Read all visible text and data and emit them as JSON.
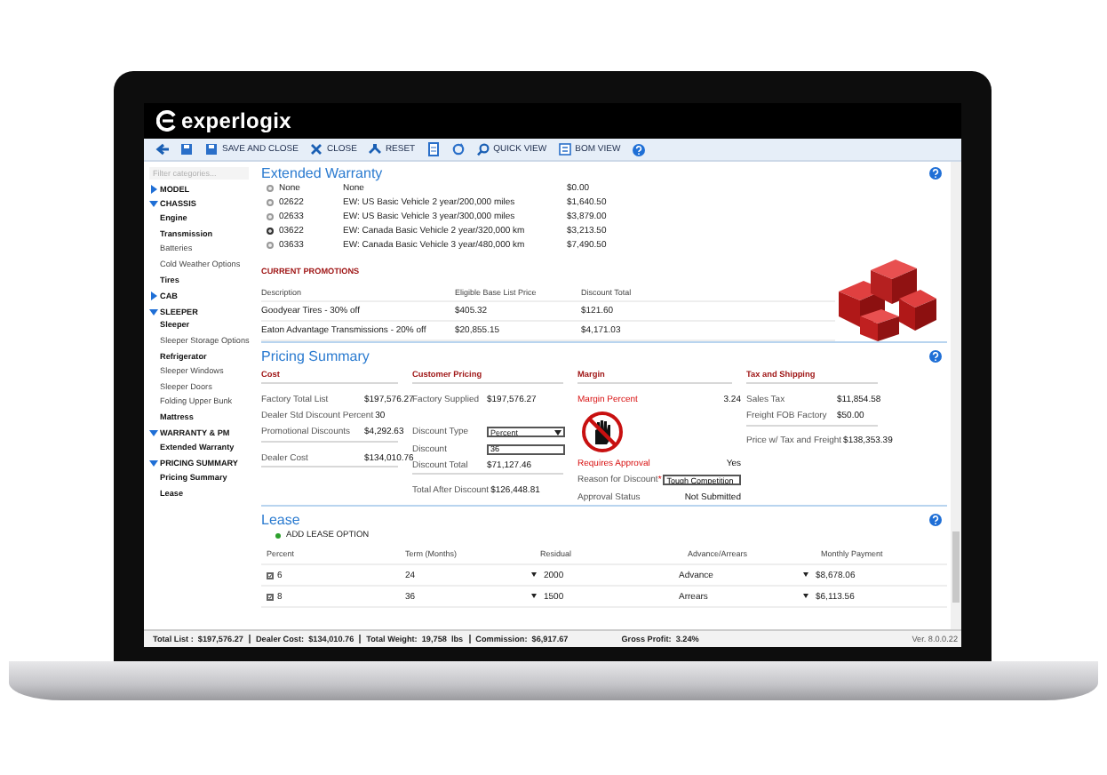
{
  "app": {
    "logo": "experlogix"
  },
  "toolbar": [
    "SAVE AND CLOSE",
    "CLOSE",
    "RESET",
    "QUICK VIEW",
    "BOM VIEW"
  ],
  "sidebar": {
    "filter_placeholder": "Filter categories...",
    "items": [
      {
        "label": "MODEL",
        "expanded": false
      },
      {
        "label": "CHASSIS",
        "expanded": true,
        "children": [
          {
            "label": "Engine",
            "completed": true
          },
          {
            "label": "Transmission",
            "completed": true
          },
          {
            "label": "Batteries",
            "completed": false
          },
          {
            "label": "Cold Weather Options",
            "completed": false
          },
          {
            "label": "Tires",
            "completed": true
          }
        ]
      },
      {
        "label": "CAB",
        "expanded": false
      },
      {
        "label": "SLEEPER",
        "expanded": true,
        "children": [
          {
            "label": "Sleeper",
            "completed": true
          },
          {
            "label": "Sleeper Storage Options",
            "completed": false
          },
          {
            "label": "Refrigerator",
            "completed": true
          },
          {
            "label": "Sleeper Windows",
            "completed": false
          },
          {
            "label": "Sleeper Doors",
            "completed": false
          },
          {
            "label": "Folding Upper Bunk",
            "completed": false
          },
          {
            "label": "Mattress",
            "completed": true
          }
        ]
      },
      {
        "label": "WARRANTY & PM",
        "expanded": true,
        "children": [
          {
            "label": "Extended Warranty",
            "completed": true
          }
        ]
      },
      {
        "label": "PRICING SUMMARY",
        "expanded": true,
        "children": [
          {
            "label": "Pricing Summary",
            "completed": true
          },
          {
            "label": "Lease",
            "completed": true
          }
        ]
      }
    ]
  },
  "extended_warranty": {
    "title": "Extended Warranty",
    "options": [
      {
        "code": "None",
        "description": "None",
        "price": "$0.00",
        "selected": false
      },
      {
        "code": "02622",
        "description": "EW: US Basic Vehicle 2 year/200,000 miles",
        "price": "$1,640.50",
        "selected": false
      },
      {
        "code": "02633",
        "description": "EW: US Basic Vehicle 3 year/300,000 miles",
        "price": "$3,879.00",
        "selected": false
      },
      {
        "code": "03622",
        "description": "EW: Canada Basic Vehicle 2 year/320,000 km",
        "price": "$3,213.50",
        "selected": true
      },
      {
        "code": "03633",
        "description": "EW: Canada Basic Vehicle 3 year/480,000 km",
        "price": "$7,490.50",
        "selected": false
      }
    ],
    "promotions": {
      "title": "CURRENT PROMOTIONS",
      "columns": [
        "Description",
        "Eligible Base List Price",
        "Discount Total"
      ],
      "rows": [
        [
          "Goodyear Tires - 30% off",
          "$405.32",
          "$121.60"
        ],
        [
          "Eaton Advantage Transmissions - 20% off",
          "$20,855.15",
          "$4,171.03"
        ]
      ]
    }
  },
  "pricing_summary": {
    "title": "Pricing Summary",
    "columns": [
      {
        "heading": "Cost",
        "rows": [
          {
            "kind": "divider"
          },
          {
            "kind": "field",
            "label": "Factory Total List",
            "value": "$197,576.27",
            "alert": false
          },
          {
            "kind": "field",
            "label": "Dealer Std Discount Percent",
            "value": "30",
            "alert": false
          },
          {
            "kind": "field",
            "label": "Promotional Discounts",
            "value": "$4,292.63",
            "alert": false
          },
          {
            "kind": "divider"
          },
          {
            "kind": "field",
            "label": "Dealer Cost",
            "value": "$134,010.76",
            "alert": false
          },
          {
            "kind": "divider"
          }
        ]
      },
      {
        "heading": "Customer Pricing",
        "rows": [
          {
            "kind": "divider"
          },
          {
            "kind": "field",
            "label": "Factory Supplied",
            "value": "$197,576.27",
            "alert": false
          },
          {
            "kind": "blank"
          },
          {
            "kind": "select",
            "label": "Discount Type",
            "value": "Percent",
            "alert": false
          },
          {
            "kind": "input",
            "label": "Discount",
            "value": "36",
            "alert": false
          },
          {
            "kind": "field",
            "label": "Discount Total",
            "value": "$71,127.46",
            "alert": false
          },
          {
            "kind": "divider"
          },
          {
            "kind": "field",
            "label": "Total After Discount",
            "value": "$126,448.81",
            "alert": false
          }
        ]
      },
      {
        "heading": "Margin",
        "rows": [
          {
            "kind": "divider"
          },
          {
            "kind": "field",
            "label": "Margin Percent",
            "value": "3.24",
            "alert": true
          },
          {
            "kind": "icon"
          },
          {
            "kind": "field",
            "label": "Requires Approval",
            "value": "Yes",
            "alert": true
          },
          {
            "kind": "input",
            "label": "Reason for Discount",
            "required_mark": "*",
            "value": "Tough Competition",
            "alert": false
          },
          {
            "kind": "field",
            "label": "Approval Status",
            "value": "Not Submitted",
            "alert": false
          }
        ]
      },
      {
        "heading": "Tax and Shipping",
        "rows": [
          {
            "kind": "divider"
          },
          {
            "kind": "field",
            "label": "Sales Tax",
            "value": "$11,854.58",
            "alert": false
          },
          {
            "kind": "field",
            "label": "Freight FOB Factory",
            "value": "$50.00",
            "alert": false
          },
          {
            "kind": "divider"
          },
          {
            "kind": "field",
            "label": "Price w/ Tax and Freight",
            "value": "$138,353.39",
            "alert": false
          }
        ]
      }
    ]
  },
  "lease": {
    "title": "Lease",
    "add_label": "ADD LEASE OPTION",
    "columns": [
      "Percent",
      "Term (Months)",
      "Residual",
      "Advance/Arrears",
      "Monthly Payment"
    ],
    "rows": [
      {
        "checked": true,
        "percent": "6",
        "term": "24",
        "residual": "2000",
        "advance_arrears": "Advance",
        "monthly_payment": "$8,678.06"
      },
      {
        "checked": true,
        "percent": "8",
        "term": "36",
        "residual": "1500",
        "advance_arrears": "Arrears",
        "monthly_payment": "$6,113.56"
      }
    ]
  },
  "status_bar": {
    "items": [
      {
        "label": "Total List :",
        "value": "$197,576.27"
      },
      {
        "label": "Dealer Cost:",
        "value": "$134,010.76"
      },
      {
        "label": "Total Weight:",
        "value": "19,758  lbs"
      },
      {
        "label": "Commission:",
        "value": "$6,917.67"
      },
      {
        "label": "Gross Profit:",
        "value": "3.24%"
      }
    ],
    "version": "Ver. 8.0.0.22"
  }
}
